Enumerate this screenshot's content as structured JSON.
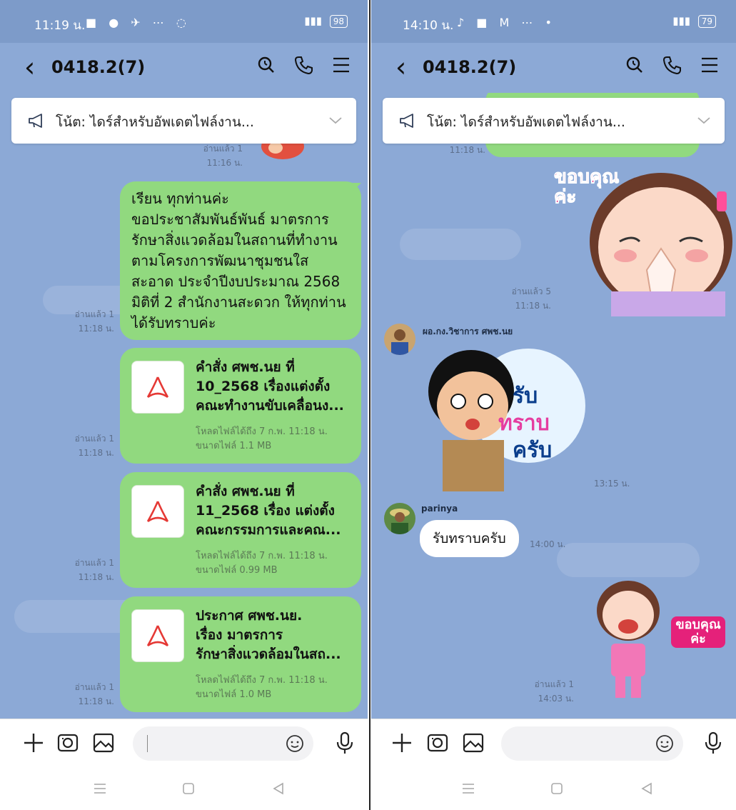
{
  "left": {
    "status": {
      "time": "11:19 น.",
      "battery": "98"
    },
    "header": {
      "title": "0418.2(7)"
    },
    "notice": {
      "text": "โน้ต: ไดร์สำหรับอัพเดตไฟล์งาน..."
    },
    "messages": {
      "prev_read": "อ่านแล้ว 1",
      "prev_time": "11:16 น.",
      "text_bubble": {
        "lines": [
          "เรียน ทุกท่านค่ะ",
          "ขอประชาสัมพันธ์พันธ์ มาตรการ",
          "รักษาสิ่งแวดล้อมในสถานที่ทำงาน",
          "ตามโครงการพัฒนาชุมชนใส",
          "สะอาด ประจำปีงบประมาณ 2568",
          "มิติที่ 2 สำนักงานสะดวก ให้ทุกท่าน",
          "ได้รับทราบค่ะ"
        ],
        "read": "อ่านแล้ว 1",
        "time": "11:18 น."
      },
      "files": [
        {
          "name": [
            "คำสั่ง ศพช.นย ที่",
            "10_2568 เรื่องแต่งตั้ง",
            "คณะทำงานขับเคลื่อนง..."
          ],
          "download": "โหลดไฟล์ได้ถึง 7 ก.พ. 11:18 น.",
          "size": "ขนาดไฟล์ 1.1 MB",
          "read": "อ่านแล้ว 1",
          "time": "11:18 น."
        },
        {
          "name": [
            "คำสั่ง ศพช.นย ที่",
            "11_2568 เรื่อง แต่งตั้ง",
            "คณะกรรมการและคณ..."
          ],
          "download": "โหลดไฟล์ได้ถึง 7 ก.พ. 11:18 น.",
          "size": "ขนาดไฟล์ 0.99 MB",
          "read": "อ่านแล้ว 1",
          "time": "11:18 น."
        },
        {
          "name": [
            "ประกาศ ศพช.นย.",
            "เรื่อง มาตรการ",
            "รักษาสิ่งแวดล้อมในสถ..."
          ],
          "download": "โหลดไฟล์ได้ถึง 7 ก.พ. 11:18 น.",
          "size": "ขนาดไฟล์ 1.0 MB",
          "read": "อ่านแล้ว 1",
          "time": "11:18 น."
        }
      ]
    }
  },
  "right": {
    "status": {
      "time": "14:10 น.",
      "battery": "79"
    },
    "header": {
      "title": "0418.2(7)"
    },
    "notice": {
      "text": "โน้ต: ไดร์สำหรับอัพเดตไฟล์งาน..."
    },
    "messages": {
      "prev_time": "11:18 น.",
      "sticker1": {
        "text": "ขอบคุณค่ะ",
        "read": "อ่านแล้ว 5",
        "time": "11:18 น."
      },
      "sender1": {
        "name": "ผอ.กง.วิชาการ ศพช.นย",
        "sticker_words": [
          "รับ",
          "ทราบ",
          "ครับ"
        ],
        "time": "13:15 น."
      },
      "sender2": {
        "name": "parinya",
        "text": "รับทราบครับ",
        "time": "14:00 น."
      },
      "sticker2": {
        "text": "ขอบคุณค่ะ",
        "read": "อ่านแล้ว 1",
        "time": "14:03 น."
      }
    }
  },
  "colors": {
    "chat_bg": "#8ca9d6",
    "own_bubble": "#91d97f",
    "status_bg": "#7d9bc9",
    "pdf_red": "#e53935"
  },
  "icons": [
    "back-icon",
    "search-icon",
    "phone-icon",
    "menu-icon",
    "megaphone-icon",
    "chevron-down-icon",
    "plus-icon",
    "camera-icon",
    "image-icon",
    "emoji-icon",
    "mic-icon",
    "pdf-icon"
  ]
}
